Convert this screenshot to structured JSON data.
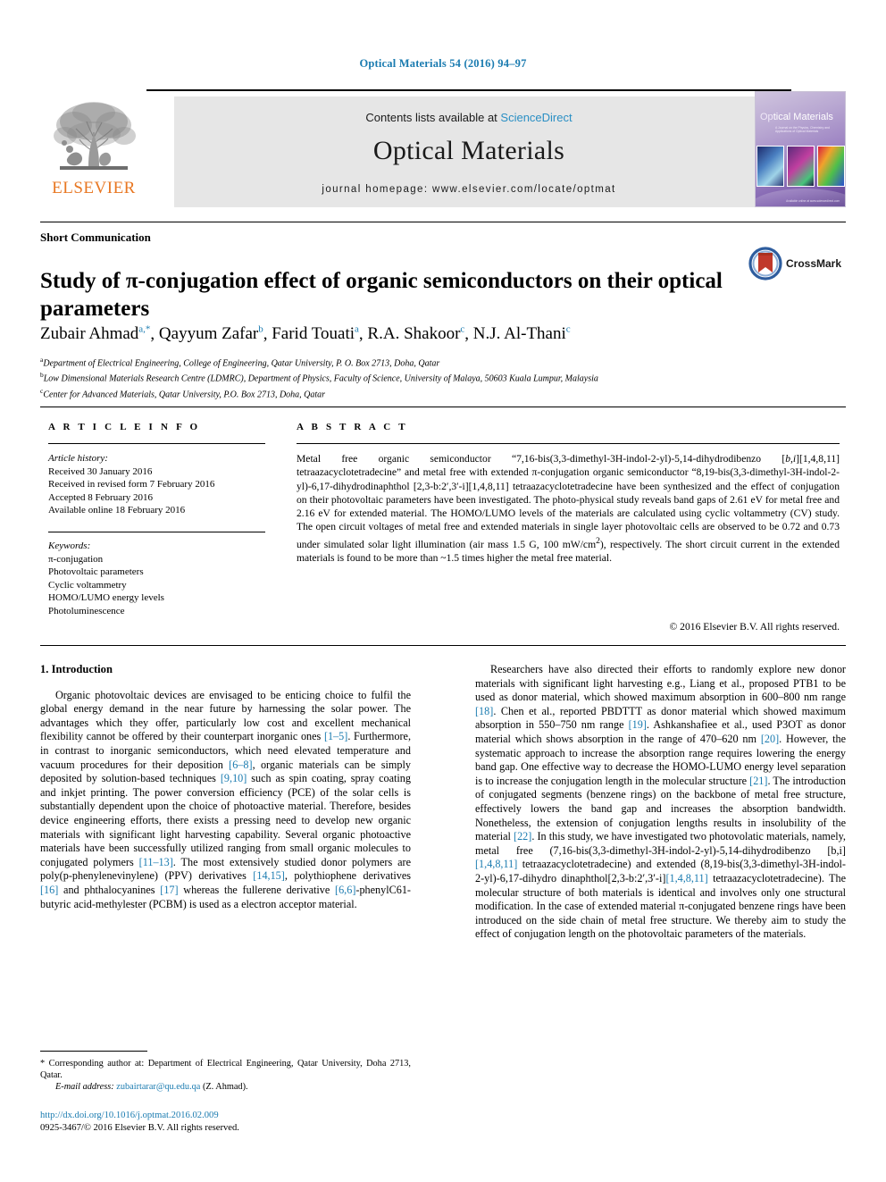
{
  "running_head": "Optical Materials 54 (2016) 94–97",
  "masthead": {
    "contents_prefix": "Contents lists available at ",
    "sciencedirect": "ScienceDirect",
    "journal_name": "Optical Materials",
    "homepage": "journal homepage: www.elsevier.com/locate/optmat",
    "publisher_wordmark": "ELSEVIER",
    "cover": {
      "title_light": "Op",
      "title_rest": "tical Materials",
      "subtitle": "A Journal on the Physics, Chemistry and Applications of Optical Materials",
      "footer": "Available online at www.sciencedirect.com"
    }
  },
  "article": {
    "section_type": "Short Communication",
    "title": "Study of π-conjugation effect of organic semiconductors on their optical parameters",
    "crossmark_label": "CrossMark",
    "authors": [
      {
        "name": "Zubair Ahmad",
        "marks": "a,*"
      },
      {
        "name": "Qayyum Zafar",
        "marks": "b"
      },
      {
        "name": "Farid Touati",
        "marks": "a"
      },
      {
        "name": "R.A. Shakoor",
        "marks": "c"
      },
      {
        "name": "N.J. Al-Thani",
        "marks": "c"
      }
    ],
    "affiliations": [
      {
        "mark": "a",
        "text": "Department of Electrical Engineering, College of Engineering, Qatar University, P. O. Box 2713, Doha, Qatar"
      },
      {
        "mark": "b",
        "text": "Low Dimensional Materials Research Centre (LDMRC), Department of Physics, Faculty of Science, University of Malaya, 50603 Kuala Lumpur, Malaysia"
      },
      {
        "mark": "c",
        "text": "Center for Advanced Materials, Qatar University, P.O. Box 2713, Doha, Qatar"
      }
    ]
  },
  "article_info": {
    "heading": "A R T I C L E   I N F O",
    "history_label": "Article history:",
    "history": [
      "Received 30 January 2016",
      "Received in revised form 7 February 2016",
      "Accepted 8 February 2016",
      "Available online 18 February 2016"
    ],
    "keywords_label": "Keywords:",
    "keywords": [
      "π-conjugation",
      "Photovoltaic parameters",
      "Cyclic voltammetry",
      "HOMO/LUMO energy levels",
      "Photoluminescence"
    ]
  },
  "abstract": {
    "heading": "A B S T R A C T",
    "text": "Metal free organic semiconductor “7,16-bis(3,3-dimethyl-3H-indol-2-yl)-5,14-dihydrodibenzo [b,i][1,4,8,11] tetraazacyclotetradecine” and metal free with extended π-conjugation organic semiconductor “8,19-bis(3,3-dimethyl-3H-indol-2-yl)-6,17-dihydrodinaphthol [2,3-b:2′,3′-i][1,4,8,11] tetraazacyclotetradecine have been synthesized and the effect of conjugation on their photovoltaic parameters have been investigated. The photo-physical study reveals band gaps of 2.61 eV for metal free and 2.16 eV for extended material. The HOMO/LUMO levels of the materials are calculated using cyclic voltammetry (CV) study. The open circuit voltages of metal free and extended materials in single layer photovoltaic cells are observed to be 0.72 and 0.73 under simulated solar light illumination (air mass 1.5 G, 100 mW/cm2), respectively. The short circuit current in the extended materials is found to be more than ~1.5 times higher the metal free material.",
    "copyright": "© 2016 Elsevier B.V. All rights reserved."
  },
  "body": {
    "section_heading": "1. Introduction",
    "left_paragraph": "Organic photovoltaic devices are envisaged to be enticing choice to fulfil the global energy demand in the near future by harnessing the solar power. The advantages which they offer, particularly low cost and excellent mechanical flexibility cannot be offered by their counterpart inorganic ones [1–5]. Furthermore, in contrast to inorganic semiconductors, which need elevated temperature and vacuum procedures for their deposition [6–8], organic materials can be simply deposited by solution-based techniques [9,10] such as spin coating, spray coating and inkjet printing. The power conversion efficiency (PCE) of the solar cells is substantially dependent upon the choice of photoactive material. Therefore, besides device engineering efforts, there exists a pressing need to develop new organic materials with significant light harvesting capability. Several organic photoactive materials have been successfully utilized ranging from small organic molecules to conjugated polymers [11–13]. The most extensively studied donor polymers are poly(p-phenylenevinylene) (PPV) derivatives [14,15], polythiophene derivatives [16] and phthalocyanines [17] whereas the fullerene derivative [6,6]-phenylC61-butyric acid-methylester (PCBM) is used as a electron acceptor material.",
    "right_paragraph": "Researchers have also directed their efforts to randomly explore new donor materials with significant light harvesting e.g., Liang et al., proposed PTB1 to be used as donor material, which showed maximum absorption in 600–800 nm range [18]. Chen et al., reported PBDTTT as donor material which showed maximum absorption in 550–750 nm range [19]. Ashkanshafiee et al., used P3OT as donor material which shows absorption in the range of 470–620 nm [20]. However, the systematic approach to increase the absorption range requires lowering the energy band gap. One effective way to decrease the HOMO-LUMO energy level separation is to increase the conjugation length in the molecular structure [21]. The introduction of conjugated segments (benzene rings) on the backbone of metal free structure, effectively lowers the band gap and increases the absorption bandwidth. Nonetheless, the extension of conjugation lengths results in insolubility of the material [22]. In this study, we have investigated two photovolatic materials, namely, metal free (7,16-bis(3,3-dimethyl-3H-indol-2-yl)-5,14-dihydrodibenzo [b,i][1,4,8,11] tetraazacyclotetradecine) and extended (8,19-bis(3,3-dimethyl-3H-indol-2-yl)-6,17-dihydro dinaphthol[2,3-b:2′,3′-i][1,4,8,11] tetraazacyclotetradecine). The molecular structure of both materials is identical and involves only one structural modification. In the case of extended material π-conjugated benzene rings have been introduced on the side chain of metal free structure. We thereby aim to study the effect of conjugation length on the photovoltaic parameters of the materials."
  },
  "footer": {
    "corresponding_note": "* Corresponding author at: Department of Electrical Engineering, Qatar University, Doha 2713, Qatar.",
    "email_label": "E-mail address:",
    "email": "zubairtarar@qu.edu.qa",
    "email_owner": "(Z. Ahmad).",
    "doi": "http://dx.doi.org/10.1016/j.optmat.2016.02.009",
    "issn_line": "0925-3467/© 2016 Elsevier B.V. All rights reserved."
  },
  "colors": {
    "link": "#1a7bb0",
    "elsevier_orange": "#e87722",
    "banner_gray": "#e6e6e6"
  }
}
